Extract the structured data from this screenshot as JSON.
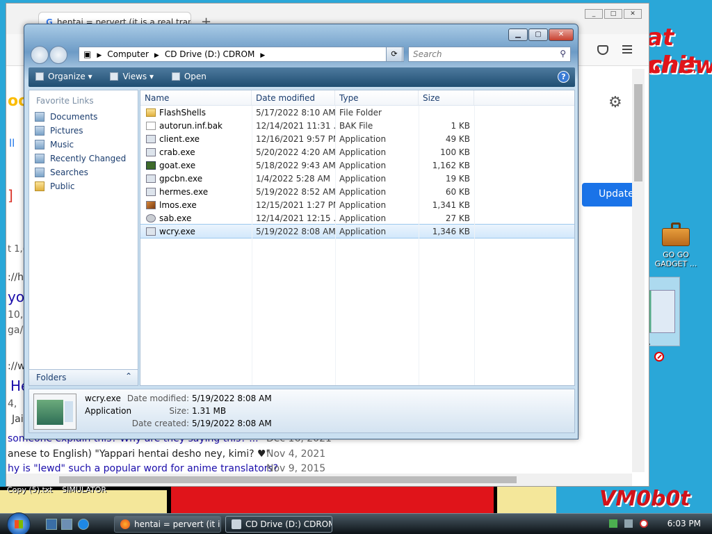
{
  "browser": {
    "tab_title": "hentai = pervert (it is a real tran",
    "newtab_symbol": "+",
    "update_label": "Update",
    "fragments": {
      "f1": "oo",
      "f2": "ll",
      "f3": "]",
      "f4": "t 1,(",
      "f5": "://hi",
      "f6": "yo",
      "f7": "10,",
      "f8": "ga/",
      "f9": "://w",
      "f10": "He",
      "f11": "4,",
      "f12": "Jai"
    },
    "results": [
      {
        "text": "someone explain this? Why are they saying this? ...",
        "date": "Dec 16, 2021"
      },
      {
        "text": "anese to English) \"Yappari hentai desho ney, kimi? ♥\"",
        "date": "Nov 4, 2021"
      },
      {
        "text": "hy is \"lewd\" such a popular word for anime translators?",
        "date": "Nov 9, 2015"
      }
    ]
  },
  "wallpaper": {
    "text1": "at shit",
    "text2": "chew",
    "signature": "VM0b0t",
    "file1": "Copy (5).txt",
    "file2": "SIMULATOR"
  },
  "desktop": {
    "icon_label": "GO GO GADGET ..."
  },
  "explorer": {
    "address": {
      "seg1": "Computer",
      "seg2": "CD Drive (D:) CDROM"
    },
    "search_placeholder": "Search",
    "toolbar": {
      "organize": "Organize",
      "views": "Views",
      "open": "Open"
    },
    "favorites_title": "Favorite Links",
    "favorites": [
      "Documents",
      "Pictures",
      "Music",
      "Recently Changed",
      "Searches",
      "Public"
    ],
    "folders_label": "Folders",
    "columns": {
      "name": "Name",
      "date": "Date modified",
      "type": "Type",
      "size": "Size"
    },
    "files": [
      {
        "name": "FlashShells",
        "date": "5/17/2022 8:10 AM",
        "type": "File Folder",
        "size": "",
        "icon": "folder"
      },
      {
        "name": "autorun.inf.bak",
        "date": "12/14/2021 11:31 ...",
        "type": "BAK File",
        "size": "1 KB",
        "icon": "bak"
      },
      {
        "name": "client.exe",
        "date": "12/16/2021 9:57 PM",
        "type": "Application",
        "size": "49 KB",
        "icon": "app"
      },
      {
        "name": "crab.exe",
        "date": "5/20/2022 4:20 AM",
        "type": "Application",
        "size": "100 KB",
        "icon": "app"
      },
      {
        "name": "goat.exe",
        "date": "5/18/2022 9:43 AM",
        "type": "Application",
        "size": "1,162 KB",
        "icon": "goat"
      },
      {
        "name": "gpcbn.exe",
        "date": "1/4/2022 5:28 AM",
        "type": "Application",
        "size": "19 KB",
        "icon": "app"
      },
      {
        "name": "hermes.exe",
        "date": "5/19/2022 8:52 AM",
        "type": "Application",
        "size": "60 KB",
        "icon": "app"
      },
      {
        "name": "lmos.exe",
        "date": "12/15/2021 1:27 PM",
        "type": "Application",
        "size": "1,341 KB",
        "icon": "lmos"
      },
      {
        "name": "sab.exe",
        "date": "12/14/2021 12:15 ...",
        "type": "Application",
        "size": "27 KB",
        "icon": "sab"
      },
      {
        "name": "wcry.exe",
        "date": "5/19/2022 8:08 AM",
        "type": "Application",
        "size": "1,346 KB",
        "icon": "app",
        "selected": true
      }
    ],
    "details": {
      "name": "wcry.exe",
      "type": "Application",
      "modified_label": "Date modified:",
      "modified_value": "5/19/2022 8:08 AM",
      "size_label": "Size:",
      "size_value": "1.31 MB",
      "created_label": "Date created:",
      "created_value": "5/19/2022 8:08 AM"
    }
  },
  "taskbar": {
    "firefox_task": "hentai = pervert (it i...",
    "explorer_task": "CD Drive (D:) CDROM",
    "clock": "6:03 PM"
  }
}
